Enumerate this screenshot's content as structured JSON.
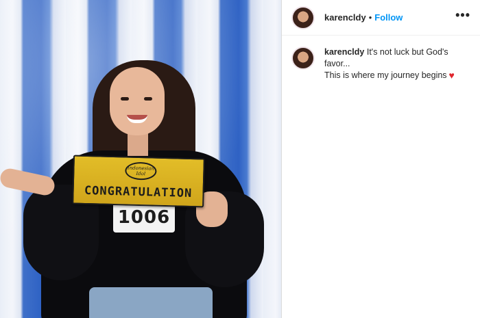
{
  "post": {
    "username": "karencldy",
    "separator": "•",
    "follow_label": "Follow",
    "more_label": "•••",
    "caption": {
      "line1": "It's not luck but God's",
      "line2": "favor...",
      "line3": "This is where my journey begins",
      "emoji": "♥"
    }
  },
  "photo": {
    "sign_text": "CONGRATULATION",
    "emblem_text": "Indonesian Idol",
    "bib_number": "1006"
  },
  "colors": {
    "follow_blue": "#0095f6",
    "heart_red": "#e0262d",
    "sign_gold": "#d9b023"
  }
}
